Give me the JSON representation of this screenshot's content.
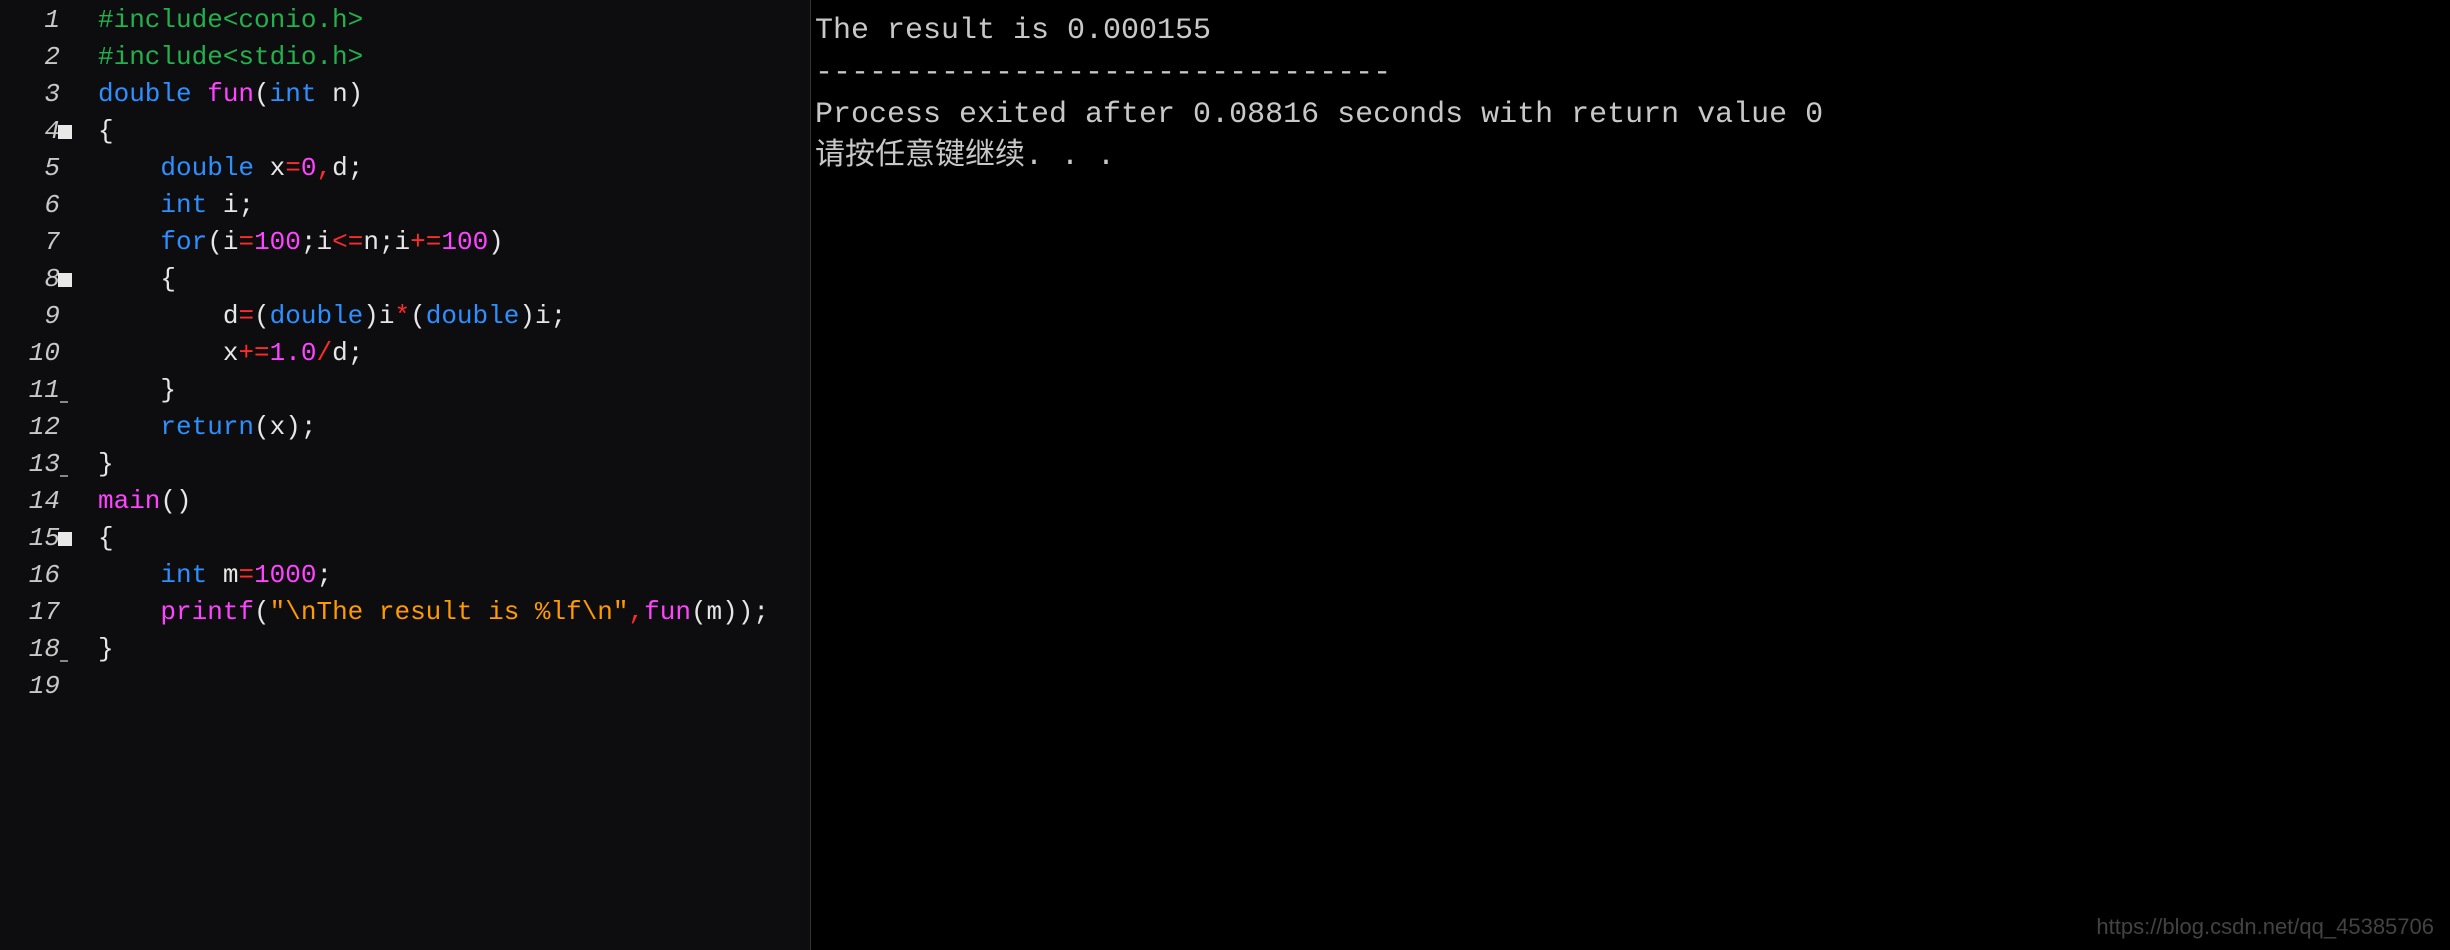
{
  "editor": {
    "lines": [
      {
        "n": "1",
        "fold": false,
        "mark": "",
        "tokens": [
          [
            "pp",
            "#include<conio.h>"
          ]
        ]
      },
      {
        "n": "2",
        "fold": false,
        "mark": "",
        "tokens": [
          [
            "pp",
            "#include<stdio.h>"
          ]
        ]
      },
      {
        "n": "3",
        "fold": false,
        "mark": "",
        "tokens": [
          [
            "kw",
            "double "
          ],
          [
            "fn",
            "fun"
          ],
          [
            "par",
            "("
          ],
          [
            "kw",
            "int "
          ],
          [
            "id",
            "n"
          ],
          [
            "par",
            ")"
          ]
        ]
      },
      {
        "n": "4",
        "fold": true,
        "mark": "",
        "tokens": [
          [
            "br",
            "{"
          ]
        ]
      },
      {
        "n": "5",
        "fold": false,
        "mark": "",
        "tokens": [
          [
            "id",
            "    "
          ],
          [
            "kw",
            "double "
          ],
          [
            "id",
            "x"
          ],
          [
            "op",
            "="
          ],
          [
            "num",
            "0"
          ],
          [
            "op",
            ","
          ],
          [
            "id",
            "d"
          ],
          [
            "semi",
            ";"
          ]
        ]
      },
      {
        "n": "6",
        "fold": false,
        "mark": "",
        "tokens": [
          [
            "id",
            "    "
          ],
          [
            "kw",
            "int "
          ],
          [
            "id",
            "i"
          ],
          [
            "semi",
            ";"
          ]
        ]
      },
      {
        "n": "7",
        "fold": false,
        "mark": "",
        "tokens": [
          [
            "id",
            "    "
          ],
          [
            "kw",
            "for"
          ],
          [
            "par",
            "("
          ],
          [
            "id",
            "i"
          ],
          [
            "op",
            "="
          ],
          [
            "num",
            "100"
          ],
          [
            "semi",
            ";"
          ],
          [
            "id",
            "i"
          ],
          [
            "op",
            "<="
          ],
          [
            "id",
            "n"
          ],
          [
            "semi",
            ";"
          ],
          [
            "id",
            "i"
          ],
          [
            "op",
            "+="
          ],
          [
            "num",
            "100"
          ],
          [
            "par",
            ")"
          ]
        ]
      },
      {
        "n": "8",
        "fold": true,
        "mark": "",
        "tokens": [
          [
            "id",
            "    "
          ],
          [
            "br",
            "{"
          ]
        ]
      },
      {
        "n": "9",
        "fold": false,
        "mark": "",
        "tokens": [
          [
            "id",
            "        d"
          ],
          [
            "op",
            "="
          ],
          [
            "par",
            "("
          ],
          [
            "kw",
            "double"
          ],
          [
            "par",
            ")"
          ],
          [
            "id",
            "i"
          ],
          [
            "op",
            "*"
          ],
          [
            "par",
            "("
          ],
          [
            "kw",
            "double"
          ],
          [
            "par",
            ")"
          ],
          [
            "id",
            "i"
          ],
          [
            "semi",
            ";"
          ]
        ]
      },
      {
        "n": "10",
        "fold": false,
        "mark": "",
        "tokens": [
          [
            "id",
            "        x"
          ],
          [
            "op",
            "+="
          ],
          [
            "num",
            "1.0"
          ],
          [
            "op",
            "/"
          ],
          [
            "id",
            "d"
          ],
          [
            "semi",
            ";"
          ]
        ]
      },
      {
        "n": "11",
        "fold": false,
        "mark": "close",
        "tokens": [
          [
            "id",
            "    "
          ],
          [
            "br",
            "}"
          ]
        ]
      },
      {
        "n": "12",
        "fold": false,
        "mark": "",
        "tokens": [
          [
            "id",
            "    "
          ],
          [
            "kw",
            "return"
          ],
          [
            "par",
            "("
          ],
          [
            "id",
            "x"
          ],
          [
            "par",
            ")"
          ],
          [
            "semi",
            ";"
          ]
        ]
      },
      {
        "n": "13",
        "fold": false,
        "mark": "close",
        "tokens": [
          [
            "br",
            "}"
          ]
        ]
      },
      {
        "n": "14",
        "fold": false,
        "mark": "",
        "tokens": [
          [
            "fn",
            "main"
          ],
          [
            "par",
            "()"
          ]
        ]
      },
      {
        "n": "15",
        "fold": true,
        "mark": "",
        "tokens": [
          [
            "br",
            "{"
          ]
        ]
      },
      {
        "n": "16",
        "fold": false,
        "mark": "",
        "tokens": [
          [
            "id",
            "    "
          ],
          [
            "kw",
            "int "
          ],
          [
            "id",
            "m"
          ],
          [
            "op",
            "="
          ],
          [
            "num",
            "1000"
          ],
          [
            "semi",
            ";"
          ]
        ]
      },
      {
        "n": "17",
        "fold": false,
        "mark": "",
        "tokens": [
          [
            "id",
            "    "
          ],
          [
            "fn",
            "printf"
          ],
          [
            "par",
            "("
          ],
          [
            "str",
            "\"\\nThe result is %lf\\n\""
          ],
          [
            "op",
            ","
          ],
          [
            "fn",
            "fun"
          ],
          [
            "par",
            "("
          ],
          [
            "id",
            "m"
          ],
          [
            "par",
            "))"
          ],
          [
            "semi",
            ";"
          ]
        ]
      },
      {
        "n": "18",
        "fold": false,
        "mark": "close",
        "tokens": [
          [
            "br",
            "}"
          ]
        ]
      },
      {
        "n": "19",
        "fold": false,
        "mark": "",
        "tokens": [
          [
            "id",
            ""
          ]
        ]
      }
    ]
  },
  "console": {
    "lines": [
      "The result is 0.000155",
      "",
      "--------------------------------",
      "Process exited after 0.08816 seconds with return value 0",
      "请按任意键继续. . ."
    ]
  },
  "watermark": "https://blog.csdn.net/qq_45385706"
}
